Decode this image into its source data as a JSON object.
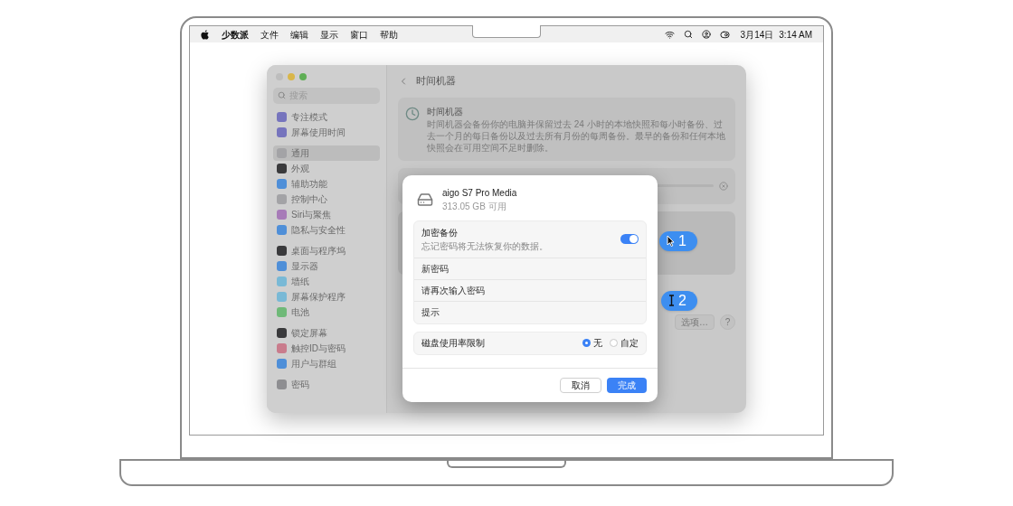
{
  "menubar": {
    "app": "少数派",
    "menus": [
      "文件",
      "编辑",
      "显示",
      "窗口",
      "帮助"
    ],
    "date": "3月14日",
    "time": "3:14 AM"
  },
  "settings_window": {
    "search": {
      "placeholder": "搜索"
    },
    "sidebar": {
      "groups": [
        [
          {
            "label": "专注模式",
            "selected": false,
            "color": "#7674bd"
          },
          {
            "label": "屏幕使用时间",
            "selected": false,
            "color": "#7674bd"
          }
        ],
        [
          {
            "label": "通用",
            "selected": true,
            "color": "#a3a3a6"
          },
          {
            "label": "外观",
            "selected": false,
            "color": "#3a3a3c"
          },
          {
            "label": "辅助功能",
            "selected": false,
            "color": "#4f8fd8"
          },
          {
            "label": "控制中心",
            "selected": false,
            "color": "#a3a3a6"
          },
          {
            "label": "Siri与聚焦",
            "selected": false,
            "color": "#a77bb8"
          },
          {
            "label": "隐私与安全性",
            "selected": false,
            "color": "#4f8fd8"
          }
        ],
        [
          {
            "label": "桌面与程序坞",
            "selected": false,
            "color": "#3a3a3c"
          },
          {
            "label": "显示器",
            "selected": false,
            "color": "#4f8fd8"
          },
          {
            "label": "墙纸",
            "selected": false,
            "color": "#79b9d6"
          },
          {
            "label": "屏幕保护程序",
            "selected": false,
            "color": "#79b9d6"
          },
          {
            "label": "电池",
            "selected": false,
            "color": "#6fb978"
          }
        ],
        [
          {
            "label": "锁定屏幕",
            "selected": false,
            "color": "#3a3a3c"
          },
          {
            "label": "触控ID与密码",
            "selected": false,
            "color": "#c97c8c"
          },
          {
            "label": "用户与群组",
            "selected": false,
            "color": "#4f8fd8"
          }
        ],
        [
          {
            "label": "密码",
            "selected": false,
            "color": "#8e8e91"
          }
        ]
      ]
    },
    "header": {
      "title": "时间机器"
    },
    "info_card": {
      "title": "时间机器",
      "description": "时间机器会备份你的电脑并保留过去 24 小时的本地快照和每小时备份、过去一个月的每日备份以及过去所有月份的每周备份。最早的备份和任何本地快照会在可用空间不足时删除。"
    },
    "buttons": [
      "选项…",
      "?"
    ]
  },
  "dialog": {
    "disk": {
      "name": "aigo S7 Pro Media",
      "free": "313.05 GB 可用"
    },
    "encrypt": {
      "label": "加密备份",
      "note": "忘记密码将无法恢复你的数据。",
      "on": true
    },
    "fields": [
      {
        "placeholder": "新密码"
      },
      {
        "placeholder": "请再次输入密码"
      },
      {
        "placeholder": "提示"
      }
    ],
    "limit": {
      "label": "磁盘使用率限制",
      "options": [
        {
          "label": "无",
          "selected": true
        },
        {
          "label": "自定",
          "selected": false
        }
      ]
    },
    "buttons": [
      {
        "label": "取消",
        "kind": "secondary"
      },
      {
        "label": "完成",
        "kind": "primary"
      }
    ]
  },
  "callouts": [
    {
      "number": "1",
      "kind": "pointer"
    },
    {
      "number": "2",
      "kind": "text-cursor"
    }
  ]
}
